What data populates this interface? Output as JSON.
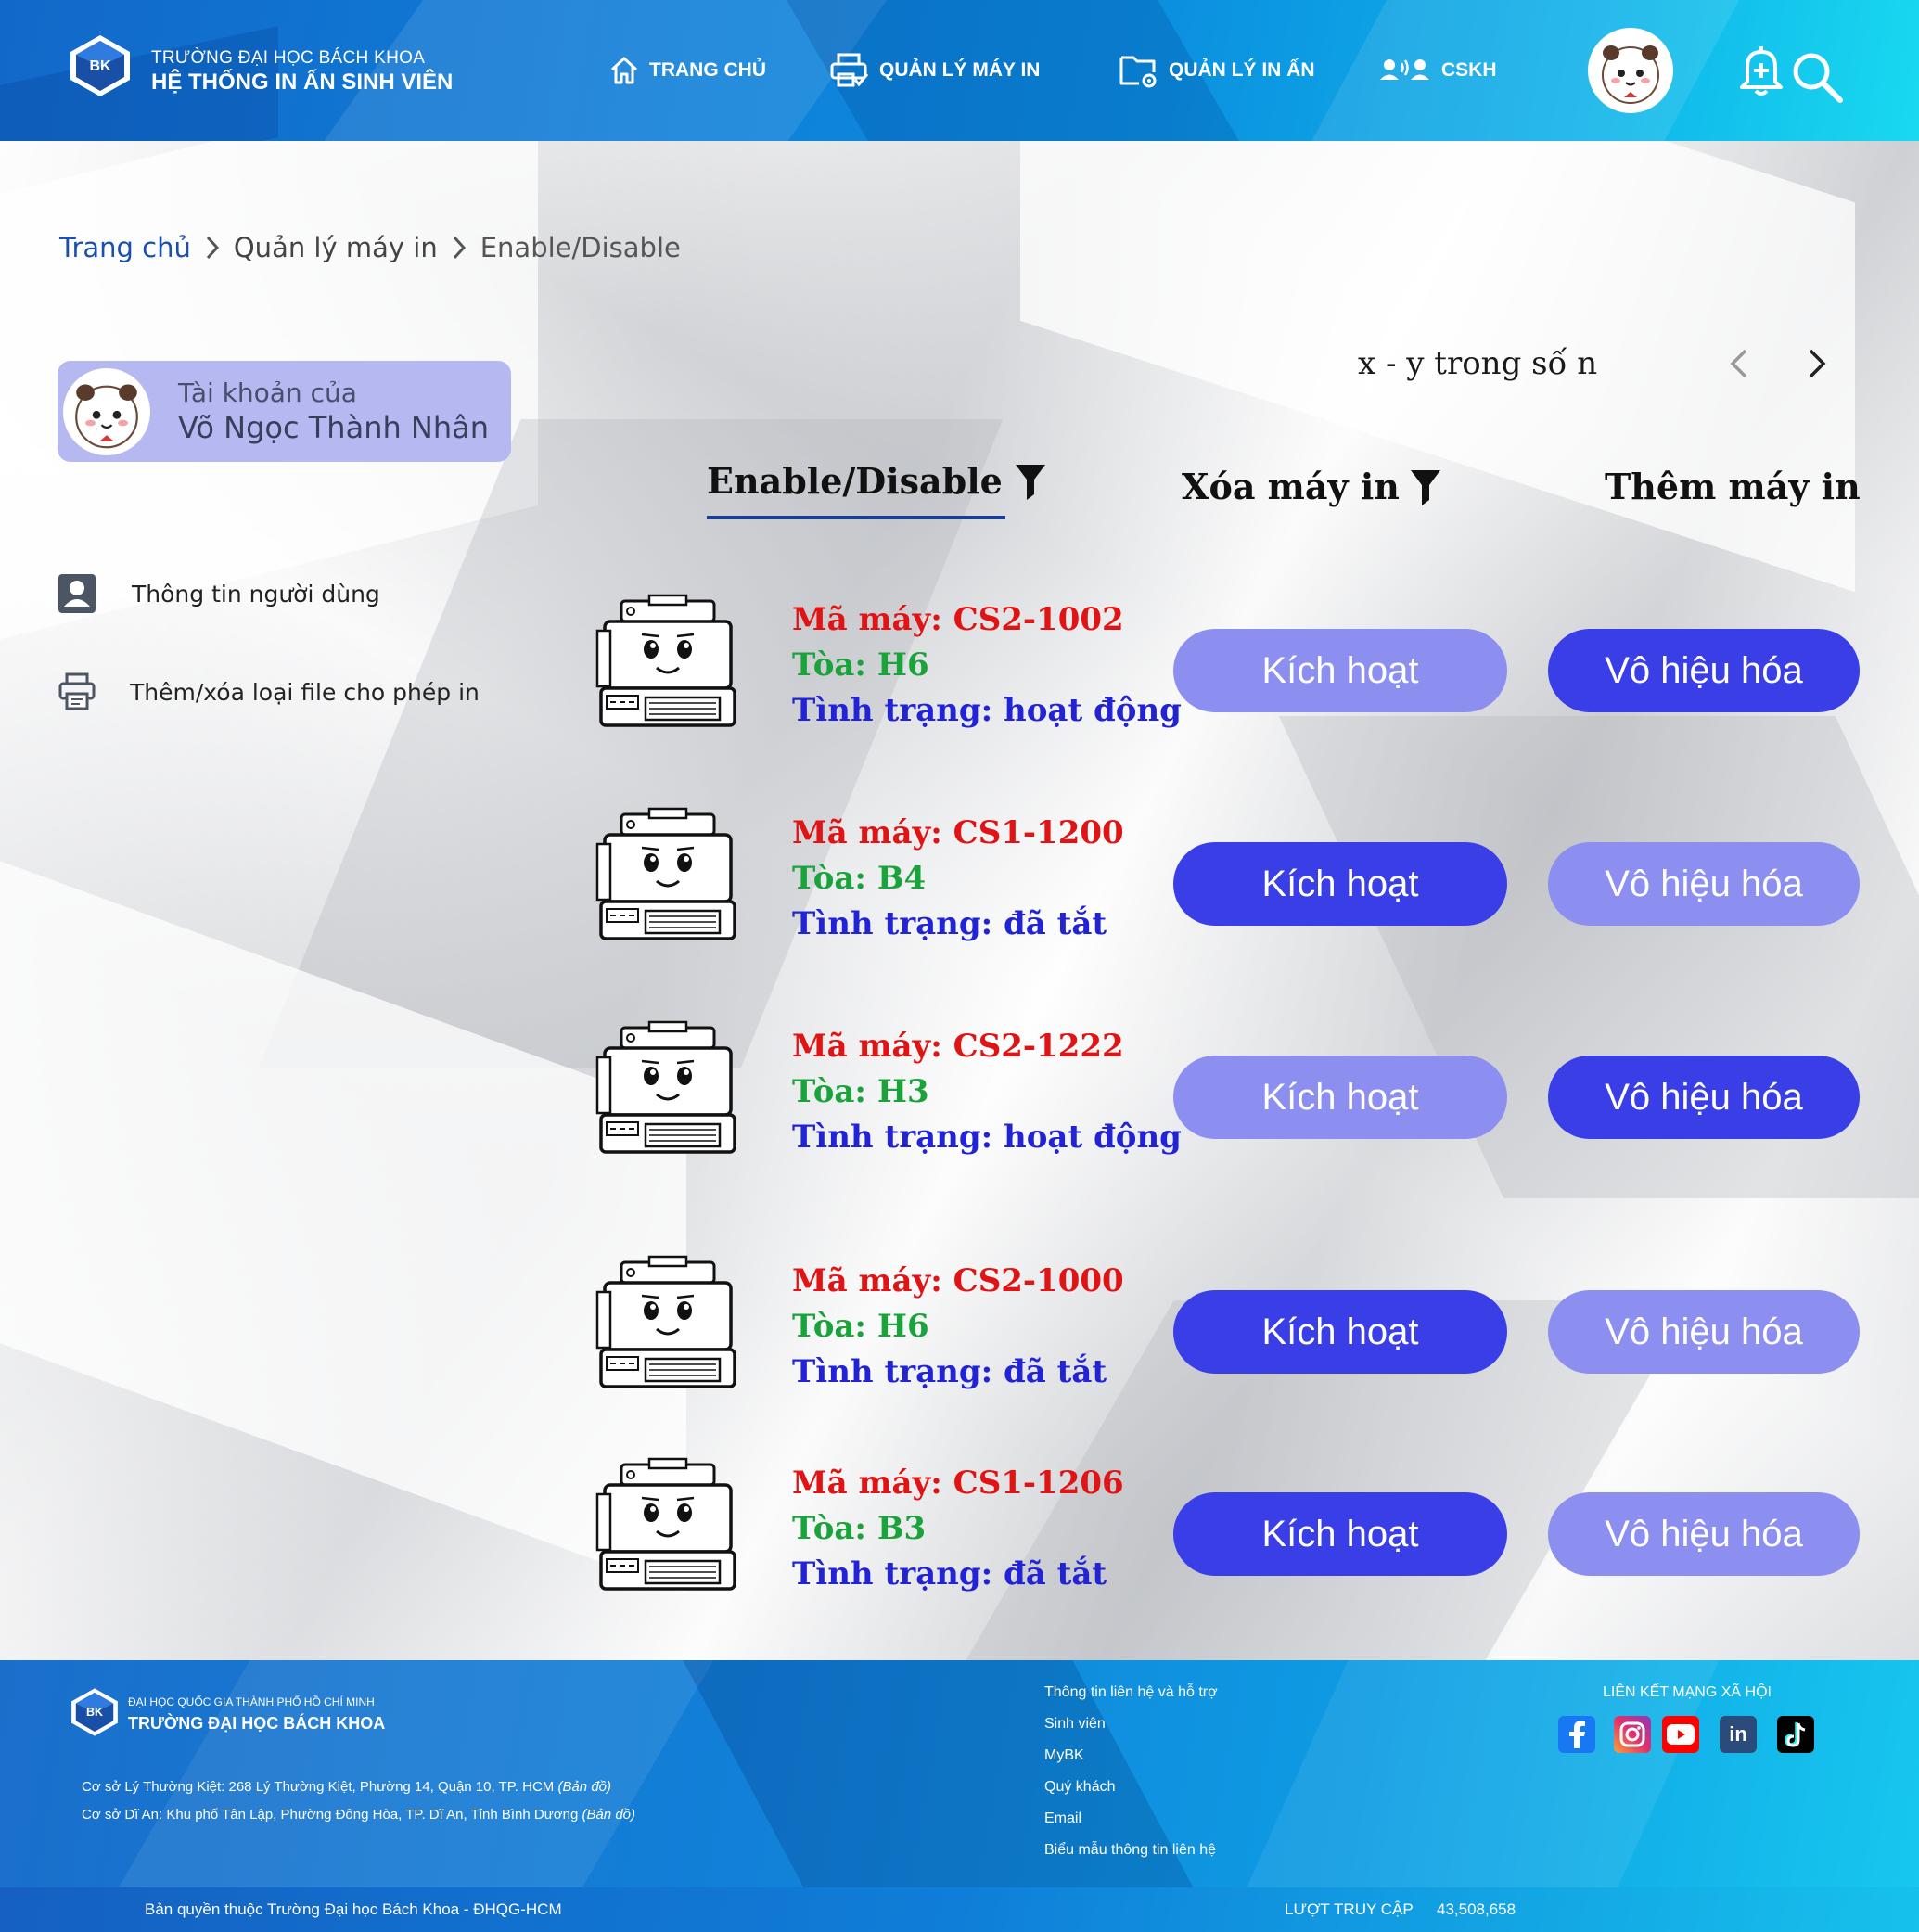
{
  "header": {
    "brand_line1": "TRƯỜNG ĐẠI HỌC BÁCH KHOA",
    "brand_line2": "HỆ THỐNG IN ẤN SINH VIÊN",
    "logo_text": "BK",
    "nav": [
      {
        "label": "TRANG CHỦ",
        "icon": "home-icon"
      },
      {
        "label": "QUẢN LÝ MÁY IN",
        "icon": "printer-check-icon"
      },
      {
        "label": "QUẢN LÝ IN ẤN",
        "icon": "folder-gear-icon"
      },
      {
        "label": "CSKH",
        "icon": "support-people-icon"
      }
    ],
    "icons": [
      "notification-bell-icon",
      "search-icon"
    ]
  },
  "breadcrumb": {
    "home": "Trang chủ",
    "section": "Quản lý máy in",
    "current": "Enable/Disable"
  },
  "account": {
    "label": "Tài khoản của",
    "name": "Võ Ngọc Thành Nhân"
  },
  "sidebar": {
    "items": [
      {
        "label": "Thông tin người dùng",
        "icon": "user-icon"
      },
      {
        "label": "Thêm/xóa loại file cho phép in",
        "icon": "printer-file-icon"
      }
    ]
  },
  "pagination": {
    "text": "x - y trong số n"
  },
  "tabs": [
    {
      "label": "Enable/Disable",
      "active": true
    },
    {
      "label": "Xóa máy in",
      "active": false
    },
    {
      "label": "Thêm máy in",
      "active": false
    }
  ],
  "printers": [
    {
      "code": "Mã máy: CS2-1002",
      "building": "Tòa: H6",
      "status": "Tình trạng: hoạt động",
      "activate": "Kích hoạt",
      "deactivate": "Vô hiệu hóa",
      "enabled": true
    },
    {
      "code": "Mã máy: CS1-1200",
      "building": "Tòa: B4",
      "status": "Tình trạng: đã tắt",
      "activate": "Kích hoạt",
      "deactivate": "Vô hiệu hóa",
      "enabled": false
    },
    {
      "code": "Mã máy: CS2-1222",
      "building": "Tòa: H3",
      "status": "Tình trạng: hoạt động",
      "activate": "Kích hoạt",
      "deactivate": "Vô hiệu hóa",
      "enabled": true
    },
    {
      "code": "Mã máy: CS2-1000",
      "building": "Tòa: H6",
      "status": "Tình trạng: đã tắt",
      "activate": "Kích hoạt",
      "deactivate": "Vô hiệu hóa",
      "enabled": false
    },
    {
      "code": "Mã máy: CS1-1206",
      "building": "Tòa: B3",
      "status": "Tình trạng: đã tắt",
      "activate": "Kích hoạt",
      "deactivate": "Vô hiệu hóa",
      "enabled": false
    }
  ],
  "colors": {
    "button_active": "#3a3ee6",
    "button_inactive": "#8c8ef0",
    "code_text": "#e01414",
    "building_text": "#1aa33a",
    "status_text": "#2323d6",
    "account_card": "#b6b8f2"
  },
  "footer": {
    "org_line1": "ĐẠI HỌC QUỐC GIA THÀNH PHỐ HỒ CHÍ MINH",
    "org_line2": "TRƯỜNG ĐẠI HỌC BÁCH KHOA",
    "address1": "Cơ sở Lý Thường Kiệt: 268 Lý Thường Kiệt, Phường 14, Quận 10, TP. HCM",
    "address2": "Cơ sở Dĩ An: Khu phố Tân Lập, Phường Đông Hòa, TP. Dĩ An, Tỉnh Bình Dương",
    "map_link": "(Bản đồ)",
    "links": [
      "Thông tin liên hệ và hỗ trợ",
      "Sinh viên",
      "MyBK",
      "Quý khách",
      "Email",
      "Biểu mẫu thông tin liên hệ"
    ],
    "social_title": "LIÊN KẾT MẠNG XÃ HỘI",
    "social": [
      "facebook-icon",
      "instagram-icon",
      "youtube-icon",
      "linkedin-icon",
      "tiktok-icon"
    ],
    "linkedin_text": "in",
    "copyright": "Bản quyền thuộc Trường Đại học Bách Khoa - ĐHQG-HCM",
    "visits_label": "LƯỢT TRUY CẬP",
    "visits_count": "43,508,658"
  }
}
